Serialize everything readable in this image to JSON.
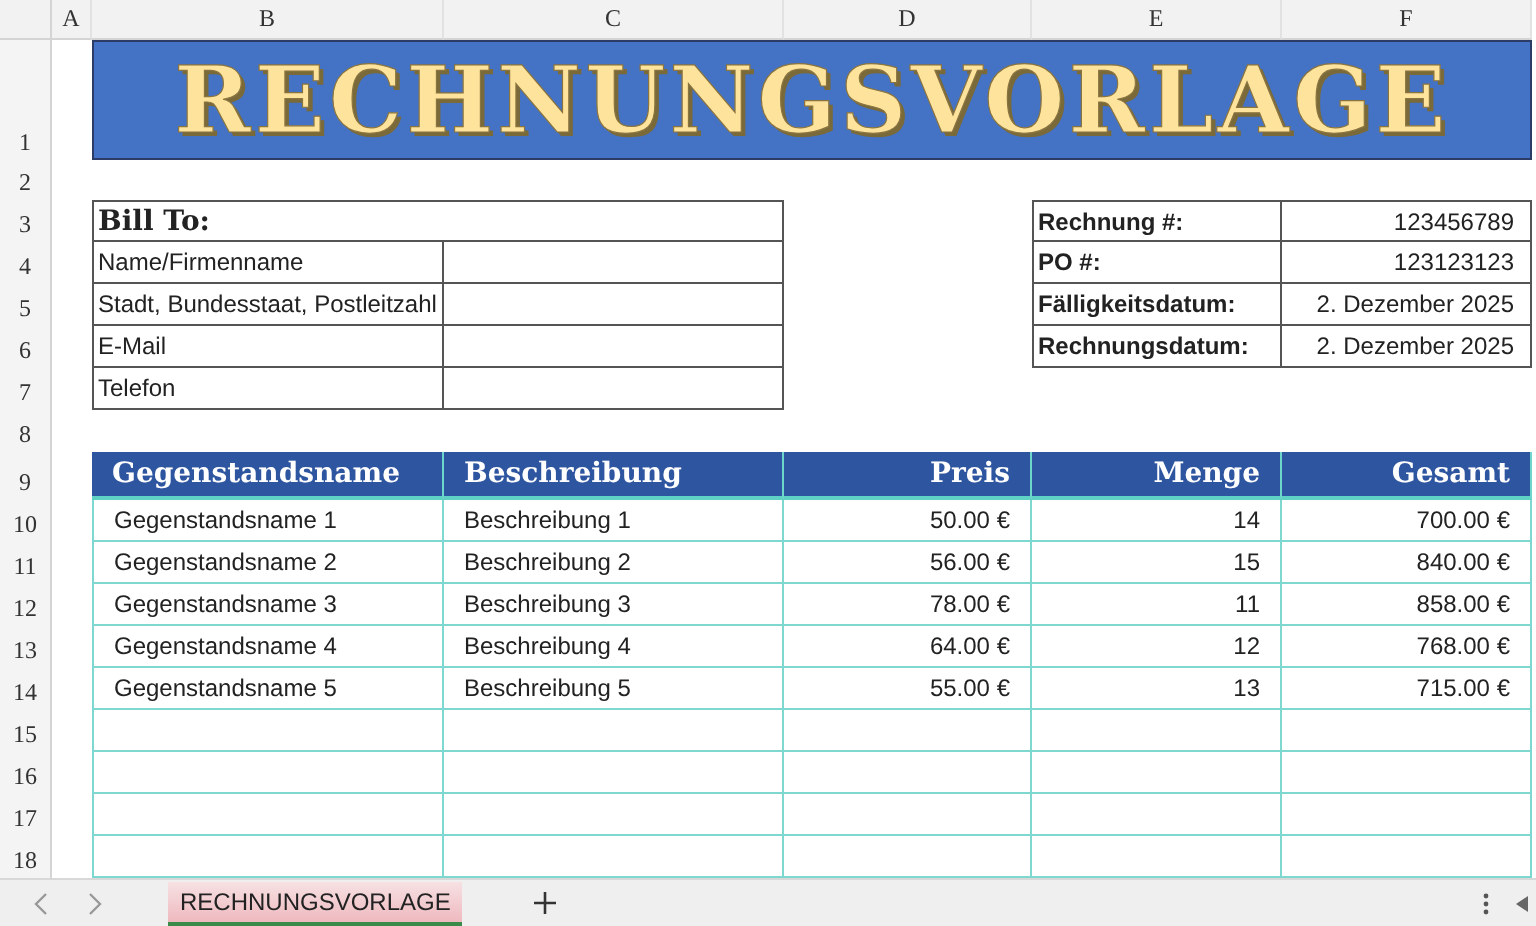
{
  "column_headers": [
    "A",
    "B",
    "C",
    "D",
    "E",
    "F"
  ],
  "row_headers": [
    "1",
    "2",
    "3",
    "4",
    "5",
    "6",
    "7",
    "8",
    "9",
    "10",
    "11",
    "12",
    "13",
    "14",
    "15",
    "16",
    "17",
    "18"
  ],
  "title": "RECHNUNGSVORLAGE",
  "bill_to": {
    "heading": "Bill To:",
    "fields": [
      "Name/Firmenname",
      "Stadt, Bundesstaat, Postleitzahl",
      "E-Mail",
      "Telefon"
    ]
  },
  "invoice_info": [
    {
      "label": "Rechnung #:",
      "value": "123456789"
    },
    {
      "label": "PO #:",
      "value": "123123123"
    },
    {
      "label": "Fälligkeitsdatum:",
      "value": "2. Dezember 2025"
    },
    {
      "label": "Rechnungsdatum:",
      "value": "2. Dezember 2025"
    }
  ],
  "items": {
    "columns": [
      "Gegenstandsname",
      "Beschreibung",
      "Preis",
      "Menge",
      "Gesamt"
    ],
    "rows": [
      [
        "Gegenstandsname 1",
        "Beschreibung 1",
        "50.00 €",
        "14",
        "700.00 €"
      ],
      [
        "Gegenstandsname 2",
        "Beschreibung 2",
        "56.00 €",
        "15",
        "840.00 €"
      ],
      [
        "Gegenstandsname 3",
        "Beschreibung 3",
        "78.00 €",
        "11",
        "858.00 €"
      ],
      [
        "Gegenstandsname 4",
        "Beschreibung 4",
        "64.00 €",
        "12",
        "768.00 €"
      ],
      [
        "Gegenstandsname 5",
        "Beschreibung 5",
        "55.00 €",
        "13",
        "715.00 €"
      ]
    ]
  },
  "sheet_tabs": [
    {
      "label": "RECHNUNGSVORLAGE",
      "selected": true
    }
  ]
}
